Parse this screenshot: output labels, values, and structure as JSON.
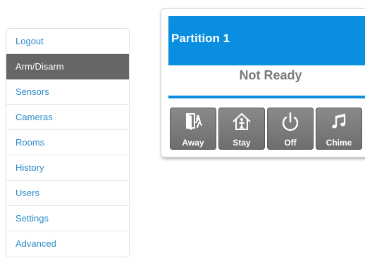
{
  "sidebar": {
    "items": [
      {
        "label": "Logout",
        "active": false
      },
      {
        "label": "Arm/Disarm",
        "active": true
      },
      {
        "label": "Sensors",
        "active": false
      },
      {
        "label": "Cameras",
        "active": false
      },
      {
        "label": "Rooms",
        "active": false
      },
      {
        "label": "History",
        "active": false
      },
      {
        "label": "Users",
        "active": false
      },
      {
        "label": "Settings",
        "active": false
      },
      {
        "label": "Advanced",
        "active": false
      }
    ]
  },
  "partition": {
    "title": "Partition 1",
    "status": "Not Ready",
    "buttons": [
      {
        "label": "Away",
        "icon": "door-exit-icon"
      },
      {
        "label": "Stay",
        "icon": "house-person-icon"
      },
      {
        "label": "Off",
        "icon": "power-icon"
      },
      {
        "label": "Chime",
        "icon": "music-note-icon"
      }
    ]
  },
  "colors": {
    "accent": "#0a8fe0",
    "link": "#2a8bc9",
    "active_nav": "#666666",
    "button": "#7a7a7a"
  }
}
